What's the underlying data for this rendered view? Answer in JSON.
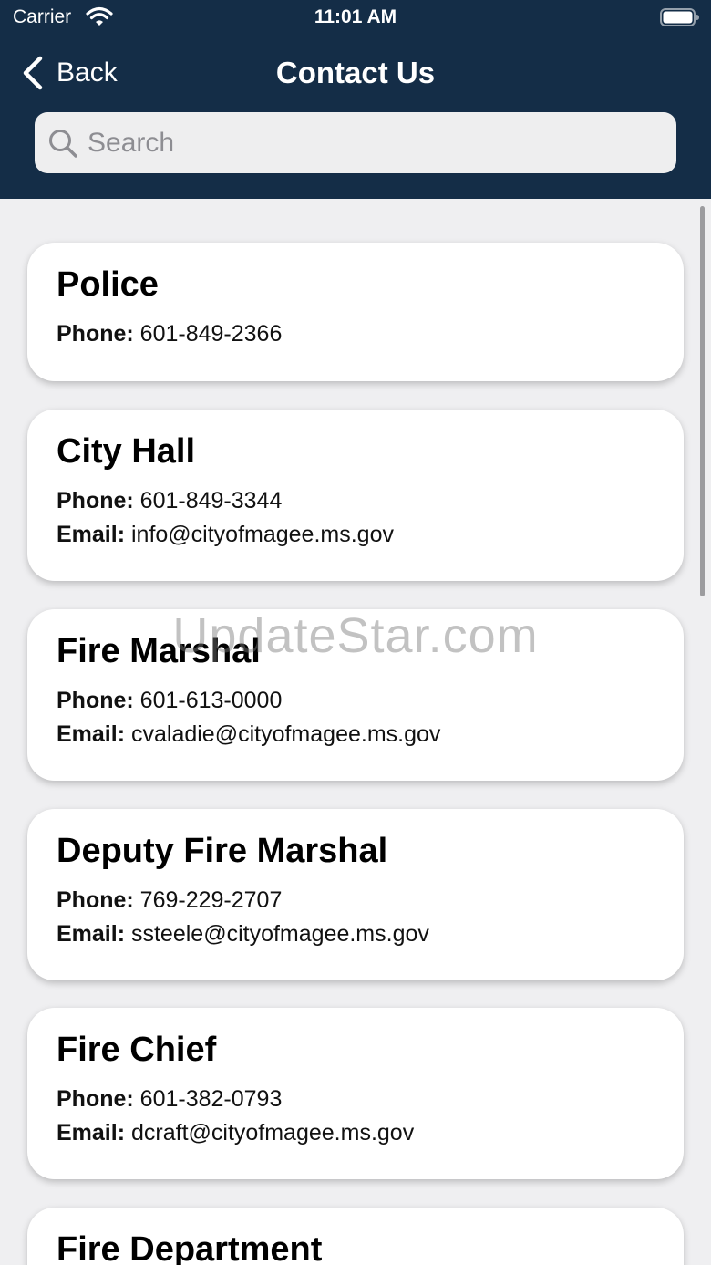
{
  "status_bar": {
    "carrier": "Carrier",
    "time": "11:01 AM"
  },
  "nav": {
    "back_label": "Back",
    "title": "Contact Us"
  },
  "search": {
    "placeholder": "Search",
    "value": ""
  },
  "labels": {
    "phone": "Phone:",
    "email": "Email:"
  },
  "contacts": [
    {
      "name": "Police",
      "phone": "601-849-2366"
    },
    {
      "name": "City Hall",
      "phone": "601-849-3344",
      "email": "info@cityofmagee.ms.gov"
    },
    {
      "name": "Fire Marshal",
      "phone": "601-613-0000",
      "email": "cvaladie@cityofmagee.ms.gov"
    },
    {
      "name": "Deputy Fire Marshal",
      "phone": "769-229-2707",
      "email": "ssteele@cityofmagee.ms.gov"
    },
    {
      "name": "Fire Chief",
      "phone": "601-382-0793",
      "email": "dcraft@cityofmagee.ms.gov"
    },
    {
      "name": "Fire Department"
    }
  ],
  "watermark": "UpdateStar.com",
  "colors": {
    "header_bg": "#142d47",
    "page_bg": "#efeff1",
    "card_bg": "#ffffff"
  }
}
